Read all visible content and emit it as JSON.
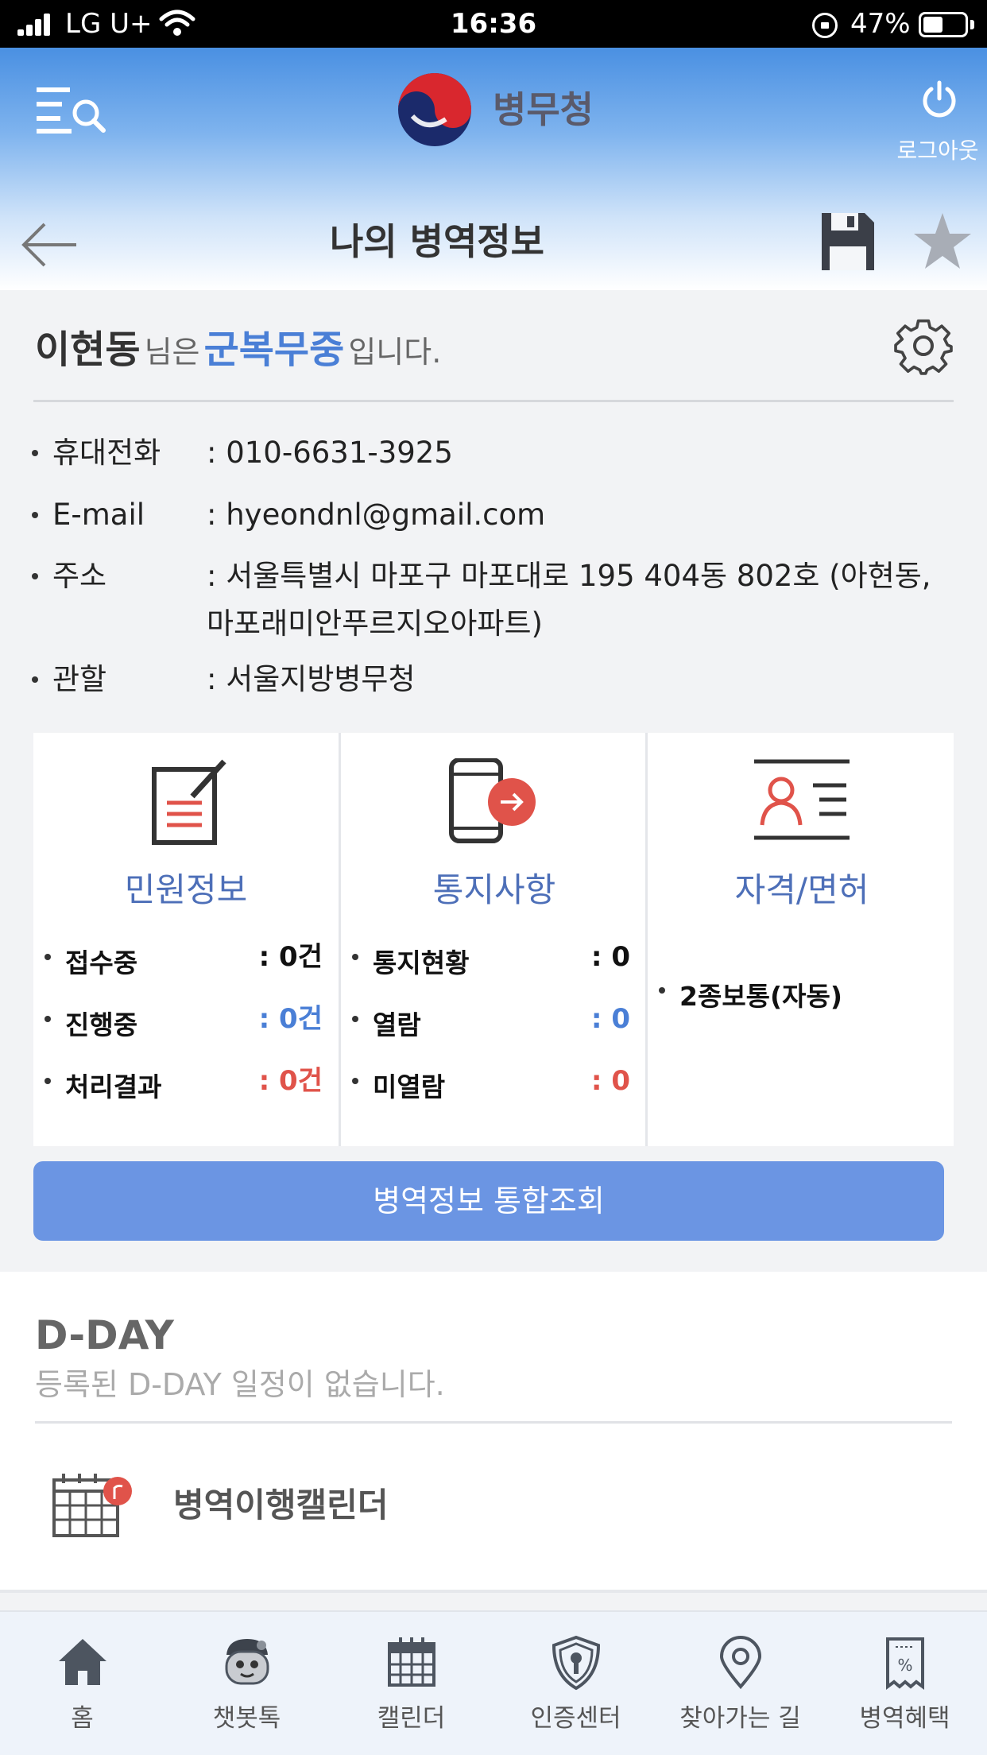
{
  "status_bar": {
    "carrier": "LG U+",
    "time": "16:36",
    "battery_percent": "47%",
    "battery_level": 0.47
  },
  "header": {
    "logo_text": "병무청",
    "logout_label": "로그아웃",
    "page_title": "나의 병역정보",
    "icons": [
      "menu-search-icon",
      "logo-emblem",
      "power-icon",
      "back-arrow-icon",
      "save-icon",
      "star-icon"
    ]
  },
  "profile": {
    "name": "이현동",
    "suffix_1": "님은",
    "status": "군복무중",
    "suffix_2": "입니다.",
    "status_color": "#4a7fd6",
    "info": [
      {
        "label": "휴대전화",
        "value": ": 010-6631-3925"
      },
      {
        "label": "E-mail",
        "value": ": hyeondnl@gmail.com"
      },
      {
        "label": "주소",
        "value": ": 서울특별시 마포구 마포대로 195 404동 802호 (아현동, 마포래미안푸르지오아파트)"
      },
      {
        "label": "관할",
        "value": ": 서울지방병무청"
      }
    ]
  },
  "cards": [
    {
      "title": "민원정보",
      "icon": "document-edit-icon",
      "stats": [
        {
          "label": "접수중",
          "value": ": 0건",
          "color": "#111111"
        },
        {
          "label": "진행중",
          "value": ": 0건",
          "color": "#4a7fd6"
        },
        {
          "label": "처리결과",
          "value": ": 0건",
          "color": "#e0534a"
        }
      ]
    },
    {
      "title": "통지사항",
      "icon": "phone-notice-icon",
      "stats": [
        {
          "label": "통지현황",
          "value": ": 0",
          "color": "#111111"
        },
        {
          "label": "열람",
          "value": ": 0",
          "color": "#4a7fd6"
        },
        {
          "label": "미열람",
          "value": ": 0",
          "color": "#e0534a"
        }
      ]
    },
    {
      "title": "자격/면허",
      "icon": "license-card-icon",
      "stats": [
        {
          "label": "2종보통(자동)",
          "value": "",
          "color": "#111111"
        }
      ]
    }
  ],
  "query_button": "병역정보 통합조회",
  "accent_color": "#6b95e3",
  "dday": {
    "title": "D-DAY",
    "empty_message": "등록된 D-DAY 일정이 없습니다.",
    "calendar_link": "병역이행캘린더"
  },
  "tabbar": [
    {
      "label": "홈",
      "icon": "home-icon"
    },
    {
      "label": "챗봇톡",
      "icon": "chatbot-icon"
    },
    {
      "label": "캘린더",
      "icon": "calendar-icon"
    },
    {
      "label": "인증센터",
      "icon": "shield-key-icon"
    },
    {
      "label": "찾아가는 길",
      "icon": "location-pin-icon"
    },
    {
      "label": "병역혜택",
      "icon": "coupon-icon"
    }
  ]
}
